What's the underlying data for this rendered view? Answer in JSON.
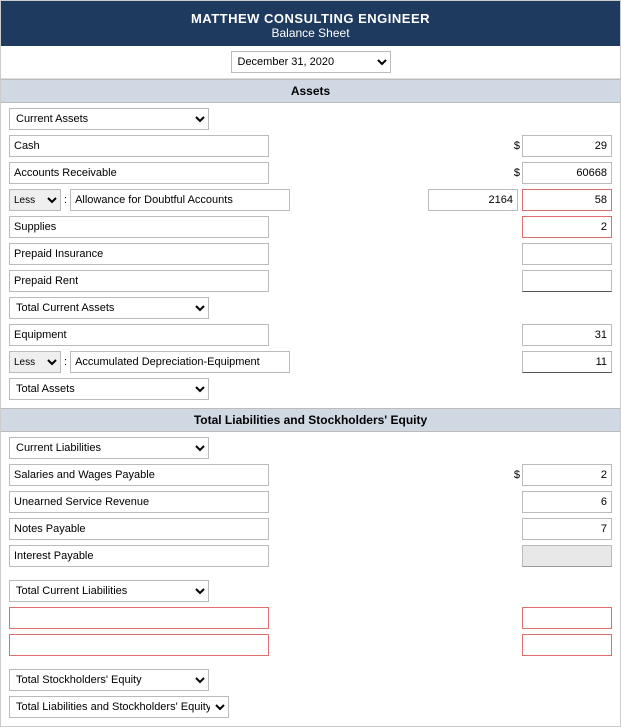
{
  "header": {
    "company": "MATTHEW CONSULTING ENGINEER",
    "sheet_type": "Balance Sheet",
    "date_label": "December 31, 2020"
  },
  "sections": {
    "assets_label": "Assets",
    "liabilities_label": "Total Liabilities and Stockholders' Equity"
  },
  "assets": {
    "current_assets_dropdown": "Current Assets",
    "cash_label": "Cash",
    "cash_amount": "29",
    "ar_label": "Accounts Receivable",
    "ar_amount": "60668",
    "less_label": "Less",
    "less_colon": ":",
    "allowance_label": "Allowance for Doubtful Accounts",
    "allowance_amount": "2164",
    "allowance_net": "58",
    "supplies_label": "Supplies",
    "supplies_amount": "2",
    "prepaid_insurance_label": "Prepaid Insurance",
    "prepaid_rent_label": "Prepaid Rent",
    "total_current_assets_dropdown": "Total Current Assets",
    "equipment_label": "Equipment",
    "equipment_amount": "31",
    "less2_label": "Less",
    "less2_colon": ":",
    "accum_dep_label": "Accumulated Depreciation-Equipment",
    "accum_dep_amount": "11",
    "total_assets_dropdown": "Total Assets"
  },
  "liabilities": {
    "current_liabilities_dropdown": "Current Liabilities",
    "salaries_label": "Salaries and Wages Payable",
    "salaries_amount": "2",
    "unearned_label": "Unearned Service Revenue",
    "unearned_amount": "6",
    "notes_label": "Notes Payable",
    "notes_amount": "7",
    "interest_label": "Interest Payable",
    "interest_amount": "",
    "total_current_liab_dropdown": "Total Current Liabilities",
    "extra_row1": "",
    "extra_row2": "",
    "extra_amount1": "",
    "extra_amount2": "",
    "total_equity_dropdown": "Total Stockholders' Equity",
    "total_liab_equity_dropdown": "Total Liabilities and Stockholders' Equity"
  },
  "dollar_sign": "$"
}
